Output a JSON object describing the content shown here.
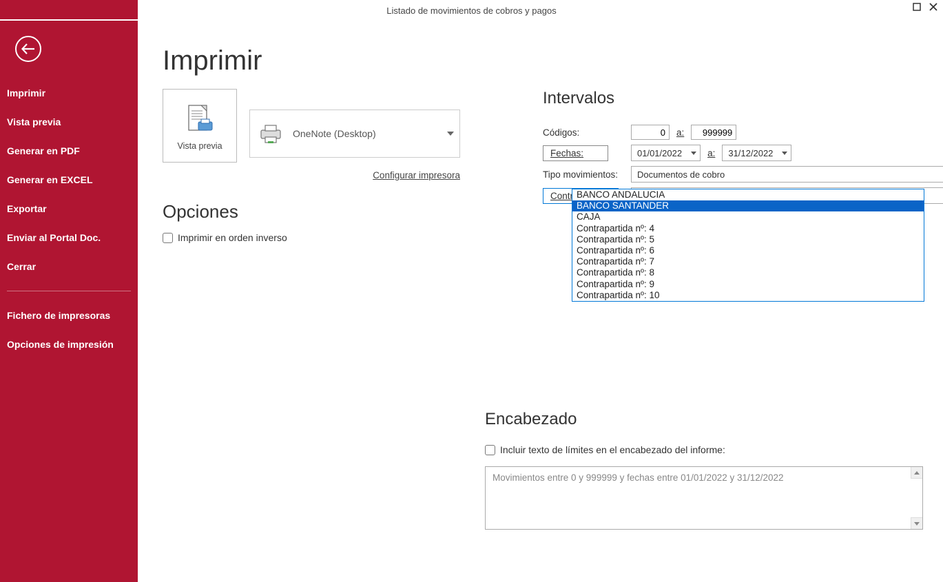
{
  "window": {
    "title": "Listado de movimientos de cobros y pagos"
  },
  "sidebar": {
    "items": [
      "Imprimir",
      "Vista previa",
      "Generar en PDF",
      "Generar en EXCEL",
      "Exportar",
      "Enviar al Portal Doc.",
      "Cerrar"
    ],
    "items2": [
      "Fichero de impresoras",
      "Opciones de impresión"
    ]
  },
  "page": {
    "title": "Imprimir",
    "preview_label": "Vista previa",
    "printer_name": "OneNote (Desktop)",
    "config_link": "Configurar impresora",
    "opciones_title": "Opciones",
    "opt_reverse": "Imprimir en orden inverso"
  },
  "intervalos": {
    "title": "Intervalos",
    "codigos_label": "Códigos:",
    "codigos_from": "0",
    "codigos_to": "999999",
    "a_label": "a:",
    "fechas_label": "Fechas:",
    "fechas_from": "01/01/2022",
    "fechas_to": "31/12/2022",
    "tipo_label": "Tipo movimientos:",
    "tipo_value": "Documentos de cobro",
    "contra_label": "Contrapartida:",
    "contra_value": "BANCO SANTANDER",
    "contra_options": [
      "BANCO ANDALUCIA",
      "BANCO SANTANDER",
      "CAJA",
      "Contrapartida nº: 4",
      "Contrapartida nº: 5",
      "Contrapartida nº: 6",
      "Contrapartida nº: 7",
      "Contrapartida nº: 8",
      "Contrapartida nº: 9",
      "Contrapartida nº: 10"
    ],
    "contra_selected_index": 1
  },
  "encabezado": {
    "title": "Encabezado",
    "include_label": "Incluir texto de límites en el encabezado del informe:",
    "text": "Movimientos entre 0 y 999999 y fechas entre 01/01/2022 y 31/12/2022"
  }
}
